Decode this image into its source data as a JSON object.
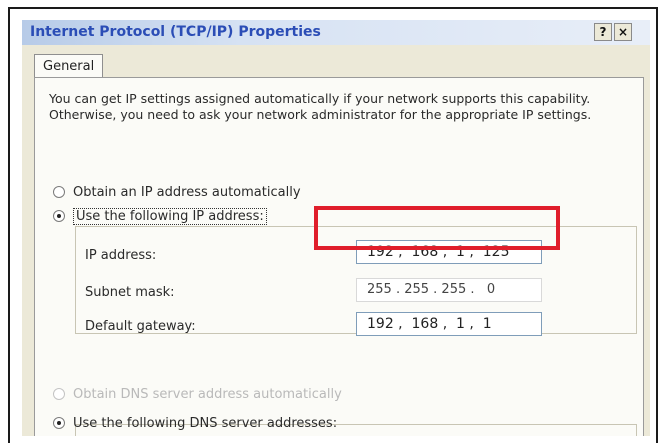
{
  "window": {
    "title": "Internet Protocol (TCP/IP) Properties",
    "help_button": "?",
    "close_button": "×"
  },
  "tabs": [
    {
      "label": "General",
      "selected": true
    }
  ],
  "intro_text": "You can get IP settings assigned automatically if your network supports this capability. Otherwise, you need to ask your network administrator for the appropriate IP settings.",
  "ip_mode": {
    "obtain_auto_label": "Obtain an IP address automatically",
    "obtain_auto_selected": false,
    "use_following_label": "Use the following IP address:",
    "use_following_selected": true
  },
  "ip_fields": {
    "ip_address_label": "IP address:",
    "ip_address_value": "192 ,  168 ,  1 ,  125",
    "subnet_mask_label": "Subnet mask:",
    "subnet_mask_value": "255 . 255 . 255 .   0",
    "default_gateway_label": "Default gateway:",
    "default_gateway_value": "192 ,  168 ,  1 ,  1"
  },
  "dns_mode": {
    "obtain_auto_label": "Obtain DNS server address automatically",
    "obtain_auto_enabled": false,
    "use_following_label": "Use the following DNS server addresses:",
    "use_following_selected": true
  },
  "colors": {
    "title_text": "#2b4db6",
    "highlight_border": "#e01e2b",
    "dialog_face": "#ece9d8"
  }
}
